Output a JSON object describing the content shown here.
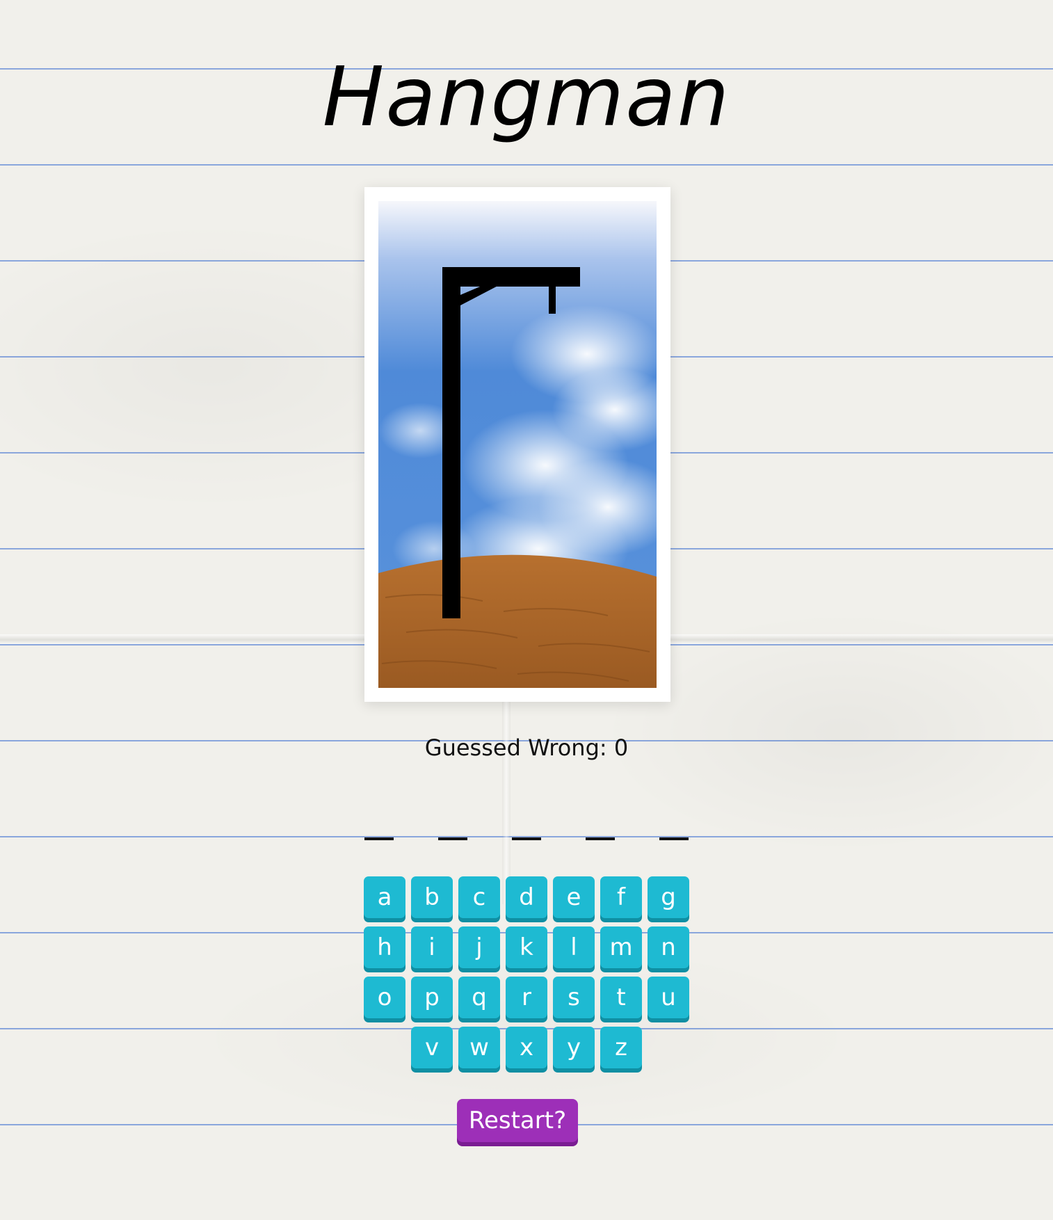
{
  "title": "Hangman",
  "status": {
    "guessed_wrong_label": "Guessed Wrong:",
    "guessed_wrong_count": "0"
  },
  "word": {
    "blanks": [
      "_",
      "_",
      "_",
      "_",
      "_"
    ]
  },
  "keyboard": {
    "rows": [
      [
        "a",
        "b",
        "c",
        "d",
        "e",
        "f",
        "g"
      ],
      [
        "h",
        "i",
        "j",
        "k",
        "l",
        "m",
        "n"
      ],
      [
        "o",
        "p",
        "q",
        "r",
        "s",
        "t",
        "u"
      ],
      [
        "v",
        "w",
        "x",
        "y",
        "z"
      ]
    ]
  },
  "restart_label": "Restart?",
  "colors": {
    "key": "#1ebad2",
    "restart": "#9d2fb8",
    "sky": "#4a86d6",
    "ground": "#b06a2c"
  }
}
